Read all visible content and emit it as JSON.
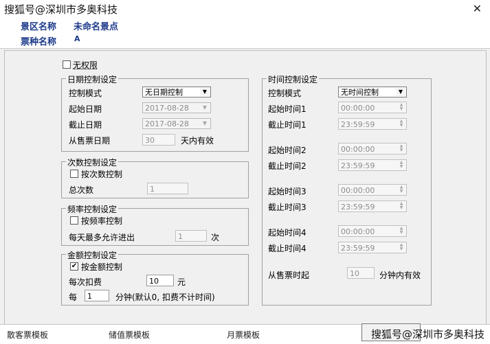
{
  "watermark_top": "搜狐号@深圳市多奥科技",
  "watermark_bottom": "搜狐号@深圳市多奥科技",
  "info": {
    "scenic_label": "景区名称",
    "scenic_value": "未命名景点",
    "ticket_label": "票种名称",
    "ticket_value": "A"
  },
  "unlimited": {
    "label": "无权限",
    "checked": false
  },
  "date_group": {
    "title": "日期控制设定",
    "mode_label": "控制模式",
    "mode_value": "无日期控制",
    "start_label": "起始日期",
    "start_value": "2017-08-28",
    "end_label": "截止日期",
    "end_value": "2017-08-28",
    "from_sale_label": "从售票日期",
    "from_sale_value": "30",
    "days_valid_label": "天内有效"
  },
  "count_group": {
    "title": "次数控制设定",
    "check_label": "按次数控制",
    "checked": false,
    "total_label": "总次数",
    "total_value": "1"
  },
  "freq_group": {
    "title": "频率控制设定",
    "check_label": "按频率控制",
    "checked": false,
    "max_label": "每天最多允许进出",
    "max_value": "1",
    "times_unit": "次"
  },
  "amount_group": {
    "title": "金额控制设定",
    "check_label": "按金额控制",
    "checked": true,
    "deduct_label": "每次扣费",
    "deduct_value": "10",
    "yuan_unit": "元",
    "per_label": "每",
    "per_value": "1",
    "per_note": "分钟(默认0, 扣费不计时间)"
  },
  "time_group": {
    "title": "时间控制设定",
    "mode_label": "控制模式",
    "mode_value": "无时间控制",
    "rows": [
      {
        "start_label": "起始时间1",
        "start_value": "00:00:00",
        "end_label": "截止时间1",
        "end_value": "23:59:59"
      },
      {
        "start_label": "起始时间2",
        "start_value": "00:00:00",
        "end_label": "截止时间2",
        "end_value": "23:59:59"
      },
      {
        "start_label": "起始时间3",
        "start_value": "00:00:00",
        "end_label": "截止时间3",
        "end_value": "23:59:59"
      },
      {
        "start_label": "起始时间4",
        "start_value": "00:00:00",
        "end_label": "截止时间4",
        "end_value": "23:59:59"
      }
    ],
    "from_sale_label": "从售票时起",
    "from_sale_value": "10",
    "minutes_valid_label": "分钟内有效"
  },
  "bottom_tabs": [
    "散客票模板",
    "储值票模板",
    "月票模板"
  ],
  "icons": {
    "close": "close-icon",
    "dropdown": "chevron-down-icon",
    "check": "checkmark-icon"
  }
}
